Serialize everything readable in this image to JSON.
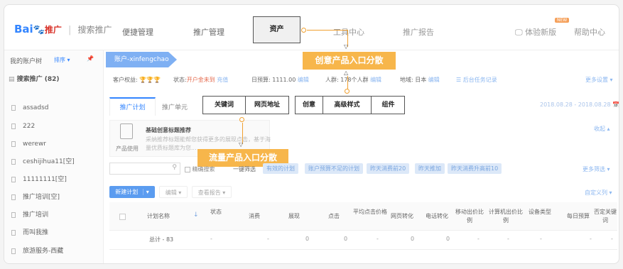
{
  "logo": {
    "bai": "Bai",
    "du": "du",
    "tuiguang": "推广",
    "sep": "|",
    "product": "搜索推广"
  },
  "nav": [
    "便捷管理",
    "推广管理",
    "资产",
    "工具中心",
    "推广报告"
  ],
  "nav_right": {
    "trial": "体验新版",
    "badge": "NEW",
    "help": "帮助中心"
  },
  "sidebar": {
    "title": "我的账户树",
    "sort": "排序",
    "account": "搜索推广 (82)",
    "items": [
      "assadsd",
      "222",
      "werewr",
      "ceshijihua11[空]",
      "11111111[空]",
      "推广培训[空]",
      "推广培训",
      "而叫我推",
      "旅游服务-西藏"
    ]
  },
  "account_tag": "账户-xinfengchao",
  "info": {
    "rights_label": "客户权益:",
    "status_label": "状态:",
    "status_value": "开户金未到",
    "status_link": "充值",
    "budget_label": "日预算: 1111.00",
    "budget_edit": "编辑",
    "crowd_label": "人群: 178个人群",
    "crowd_edit": "编辑",
    "region_label": "地域: 日本",
    "region_edit": "编辑",
    "tasks": "后台任务记录",
    "more": "更多设置"
  },
  "tabs": {
    "plan": "推广计划",
    "unit": "推广单元",
    "keyword": "关键词",
    "page": "网页地址",
    "creative": "创意",
    "advanced": "高级样式",
    "component": "组件"
  },
  "date_range": "2018.08.28 - 2018.08.28",
  "suggest": {
    "title": "基础创意标题推荐",
    "desc1": "采纳推荐标题能帮您获得更多的展现点击，基于海",
    "desc2": "量优质标题库为您...",
    "icon_label": "产品使用",
    "collapse": "收起"
  },
  "filters": {
    "precise": "精确搜索",
    "tags": [
      "一键筛选",
      "有效的计划",
      "账户预算不足的计划",
      "昨天消费前20",
      "昨天推加",
      "昨天消费升高前10"
    ],
    "more": "更多筛选"
  },
  "toolbar": {
    "new_plan": "新建计划",
    "edit": "编辑",
    "report": "查看报告",
    "custom_cols": "自定义列"
  },
  "table": {
    "headers": [
      "计划名称",
      "状态",
      "消费",
      "展现",
      "点击",
      "平均点击价格",
      "网页转化",
      "电话转化",
      "移动出价比例",
      "计算机出价比例",
      "设备类型",
      "每日预算",
      "否定关键词"
    ],
    "total_row": [
      "总计 - 83",
      "-",
      "-",
      "0",
      "0",
      "-",
      "0",
      "0",
      "-",
      "-",
      "-",
      "-",
      "-"
    ]
  },
  "annotations": {
    "creative_entry": "创意产品入口分散",
    "traffic_entry": "流量产品入口分散"
  }
}
